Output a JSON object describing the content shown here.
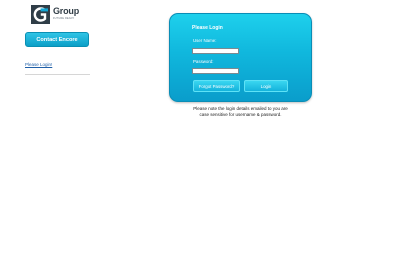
{
  "logo": {
    "word": "Group",
    "tagline": "FUTURE READY"
  },
  "sidebar": {
    "contact_label": "Contact Encore",
    "link_label": "Please Login!"
  },
  "login": {
    "title": "Please Login",
    "username_label": "User Name:",
    "username_value": "",
    "password_label": "Password:",
    "password_value": "",
    "forgot_label": "Forgot Password?",
    "login_label": "Login"
  },
  "note": {
    "line1": "Please note the login details emailed to you are",
    "line2": "case sensitive for username & password."
  },
  "colors": {
    "brand_dark": "#333f48",
    "panel_top": "#1ed0ec",
    "panel_bottom": "#0a9dcb",
    "link": "#1f5fa8"
  }
}
